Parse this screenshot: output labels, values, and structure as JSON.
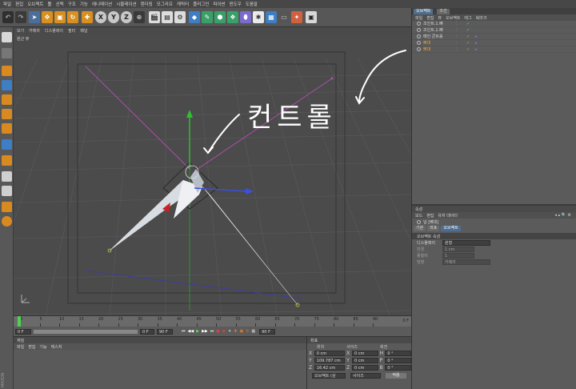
{
  "menu": [
    "파일",
    "편집",
    "오브젝트",
    "툴",
    "선택",
    "구조",
    "기능",
    "애니메이션",
    "시뮬레이션",
    "렌더링",
    "모그라프",
    "캐릭터",
    "플러그인",
    "파이썬",
    "윈도우",
    "도움말"
  ],
  "toolbar": {
    "axis_x": "X",
    "axis_y": "Y",
    "axis_z": "Z"
  },
  "viewport": {
    "menu": [
      "보기",
      "카메라",
      "디스플레이",
      "필터",
      "패널"
    ],
    "label": "원근 뷰",
    "annotation": "컨트롤"
  },
  "timeline": {
    "ticks": [
      "0",
      "5",
      "10",
      "15",
      "20",
      "25",
      "30",
      "35",
      "40",
      "45",
      "50",
      "55",
      "60",
      "65",
      "70",
      "75",
      "80",
      "85",
      "90"
    ],
    "end_label": "0 F"
  },
  "transport": {
    "start": "0 F",
    "mid": "0 F",
    "end": "90 F",
    "right": "90 F"
  },
  "material": {
    "title": "재질",
    "menu": [
      "파일",
      "편집",
      "기능",
      "텍스처"
    ]
  },
  "coords": {
    "title": "좌표",
    "headers": [
      "위치",
      "사이즈",
      "회전"
    ],
    "rows": [
      {
        "axis": "X",
        "pos": "0 cm",
        "size": "0 cm",
        "rot_axis": "H",
        "rot": "0 °"
      },
      {
        "axis": "Y",
        "pos": "109.787 cm",
        "size": "0 cm",
        "rot_axis": "P",
        "rot": "0 °"
      },
      {
        "axis": "Z",
        "pos": "16.42 cm",
        "size": "0 cm",
        "rot_axis": "B",
        "rot": "0 °"
      }
    ],
    "mode": "오브젝트 (상",
    "size_mode": "사이즈",
    "apply": "적용"
  },
  "objects": {
    "tabs": [
      "오브젝트",
      "조건"
    ],
    "menu": [
      "파일",
      "편집",
      "뷰",
      "오브젝트",
      "태그",
      "북마크"
    ],
    "items": [
      {
        "name": "조인트.1.뼈",
        "color": "#d8d8d8"
      },
      {
        "name": "조인트.1.뼈",
        "color": "#d8d8d8"
      },
      {
        "name": "메인 콘트롤",
        "color": "#d8d8d8"
      },
      {
        "name": "뼈대",
        "color": "#f0a030"
      },
      {
        "name": "뼈대",
        "color": "#f0a030"
      }
    ]
  },
  "attributes": {
    "title": "속성",
    "menu": [
      "모드",
      "편집",
      "유저 데이터"
    ],
    "object_name": "널 [뼈대]",
    "tabs": [
      "기본",
      "좌표",
      "오브젝트"
    ],
    "section": "오브젝트 속성",
    "display_label": "디스플레이",
    "display_value": "원형",
    "fields": [
      {
        "label": "반경",
        "value": "1 cm"
      },
      {
        "label": "종횡비",
        "value": "1"
      },
      {
        "label": "방향",
        "value": "카메라"
      }
    ]
  }
}
